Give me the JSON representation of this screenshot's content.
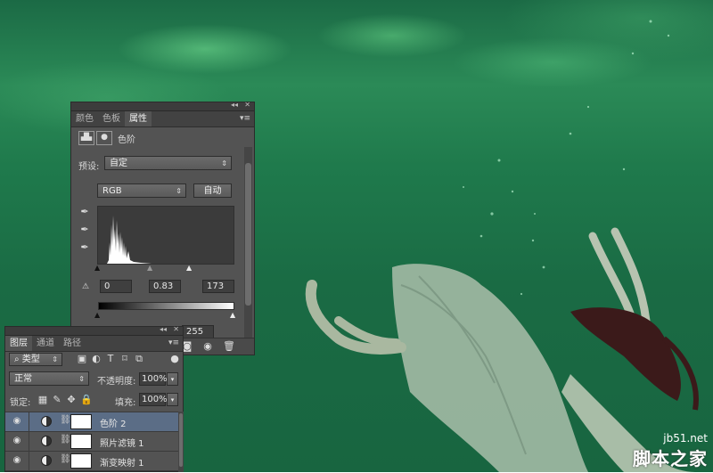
{
  "properties_panel": {
    "tabs": [
      "颜色",
      "色板",
      "属性"
    ],
    "active_tab": "属性",
    "heading": "色阶",
    "preset_label": "预设:",
    "preset_value": "自定",
    "channel_value": "RGB",
    "auto_button": "自动",
    "input_black": "0",
    "input_gamma": "0.83",
    "input_white": "173",
    "output_white": "255"
  },
  "layers_panel": {
    "tabs": [
      "图层",
      "通道",
      "路径"
    ],
    "active_tab": "图层",
    "filter_kind": "类型",
    "blend_mode": "正常",
    "opacity_label": "不透明度:",
    "opacity_value": "100%",
    "lock_label": "锁定:",
    "fill_label": "填充:",
    "fill_value": "100%",
    "layers": [
      {
        "name": "色阶 2",
        "selected": true
      },
      {
        "name": "照片滤镜 1",
        "selected": false
      },
      {
        "name": "渐变映射 1",
        "selected": false
      }
    ]
  },
  "watermark": {
    "site": "jb51.net",
    "brand": "脚本之家"
  },
  "colors": {
    "panel_bg": "#535353",
    "selected_layer": "#5b6d86",
    "water": "#1f7a4c"
  }
}
